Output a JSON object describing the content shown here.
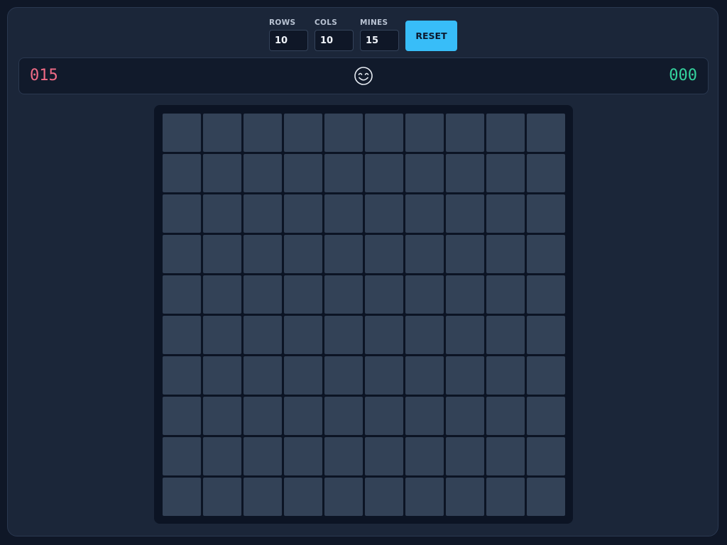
{
  "controls": {
    "rows_label": "ROWS",
    "rows_value": "10",
    "cols_label": "COLS",
    "cols_value": "10",
    "mines_label": "MINES",
    "mines_value": "15",
    "reset_label": "RESET"
  },
  "status": {
    "mine_counter": "015",
    "timer": "000",
    "face_icon": "smiling-face-icon"
  },
  "board": {
    "rows": 10,
    "cols": 10,
    "cell_state": "unrevealed"
  },
  "colors": {
    "accent": "#38bdf8",
    "mine_counter": "#f16b86",
    "timer": "#34d39e",
    "cell": "#334257"
  }
}
